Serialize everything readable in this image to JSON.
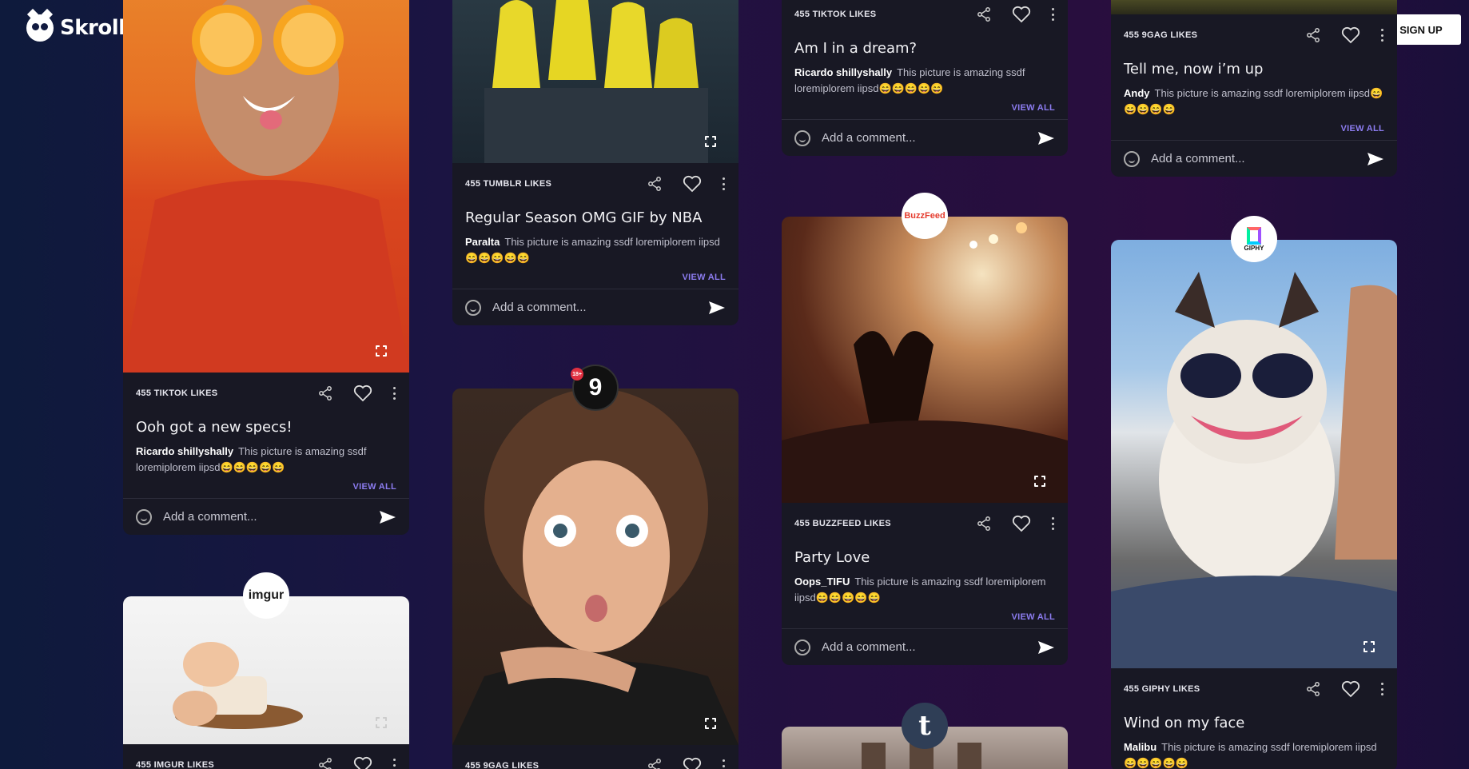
{
  "brand": {
    "name": "Skrollo",
    "signup_label": "SIGN UP"
  },
  "comment_placeholder": "Add a comment...",
  "view_all": "VIEW ALL",
  "comment_body": "This picture is amazing ssdf loremiplorem iipsd😄😄😄😄😄",
  "cards": [
    {
      "likes": "455 TIKTOK LIKES",
      "title": "Ooh got a new specs!",
      "user": "Ricardo shillyshally"
    },
    {
      "likes": "455 IMGUR LIKES",
      "title": "",
      "user": "",
      "badge": "imgur"
    },
    {
      "likes": "455 TUMBLR LIKES",
      "title": "Regular Season OMG GIF by NBA",
      "user": "Paralta"
    },
    {
      "likes": "455 9GAG LIKES",
      "title": "",
      "user": "",
      "badge": "9",
      "badge_tag": "18+"
    },
    {
      "likes": "455 TIKTOK LIKES",
      "title": "Am I in a dream?",
      "user": "Ricardo shillyshally"
    },
    {
      "likes": "455 BUZZFEED LIKES",
      "title": "Party Love",
      "user": "Oops_TIFU",
      "badge": "BuzzFeed"
    },
    {
      "likes": "",
      "title": "",
      "user": "",
      "badge": "t"
    },
    {
      "likes": "455 9GAG LIKES",
      "title": "Tell me, now i’m up",
      "user": "Andy"
    },
    {
      "likes": "455 GIPHY LIKES",
      "title": "Wind on my face",
      "user": "Malibu",
      "badge": "GIPHY"
    }
  ]
}
